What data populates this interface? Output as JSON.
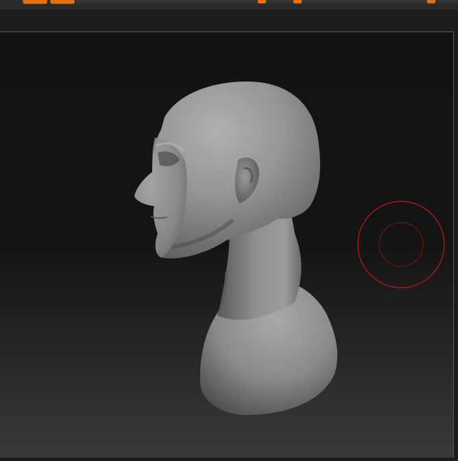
{
  "toolbar": {
    "buttons": [
      {
        "name": "toolbar-button-1",
        "color": "#e8700f"
      },
      {
        "name": "toolbar-button-2",
        "color": "#e8700f"
      }
    ],
    "slider_knob_color": "#e8700f"
  },
  "viewport": {
    "model": "bust-head-model",
    "brush_cursor": {
      "outer_color": "#b01818",
      "inner_color": "#701515"
    }
  }
}
